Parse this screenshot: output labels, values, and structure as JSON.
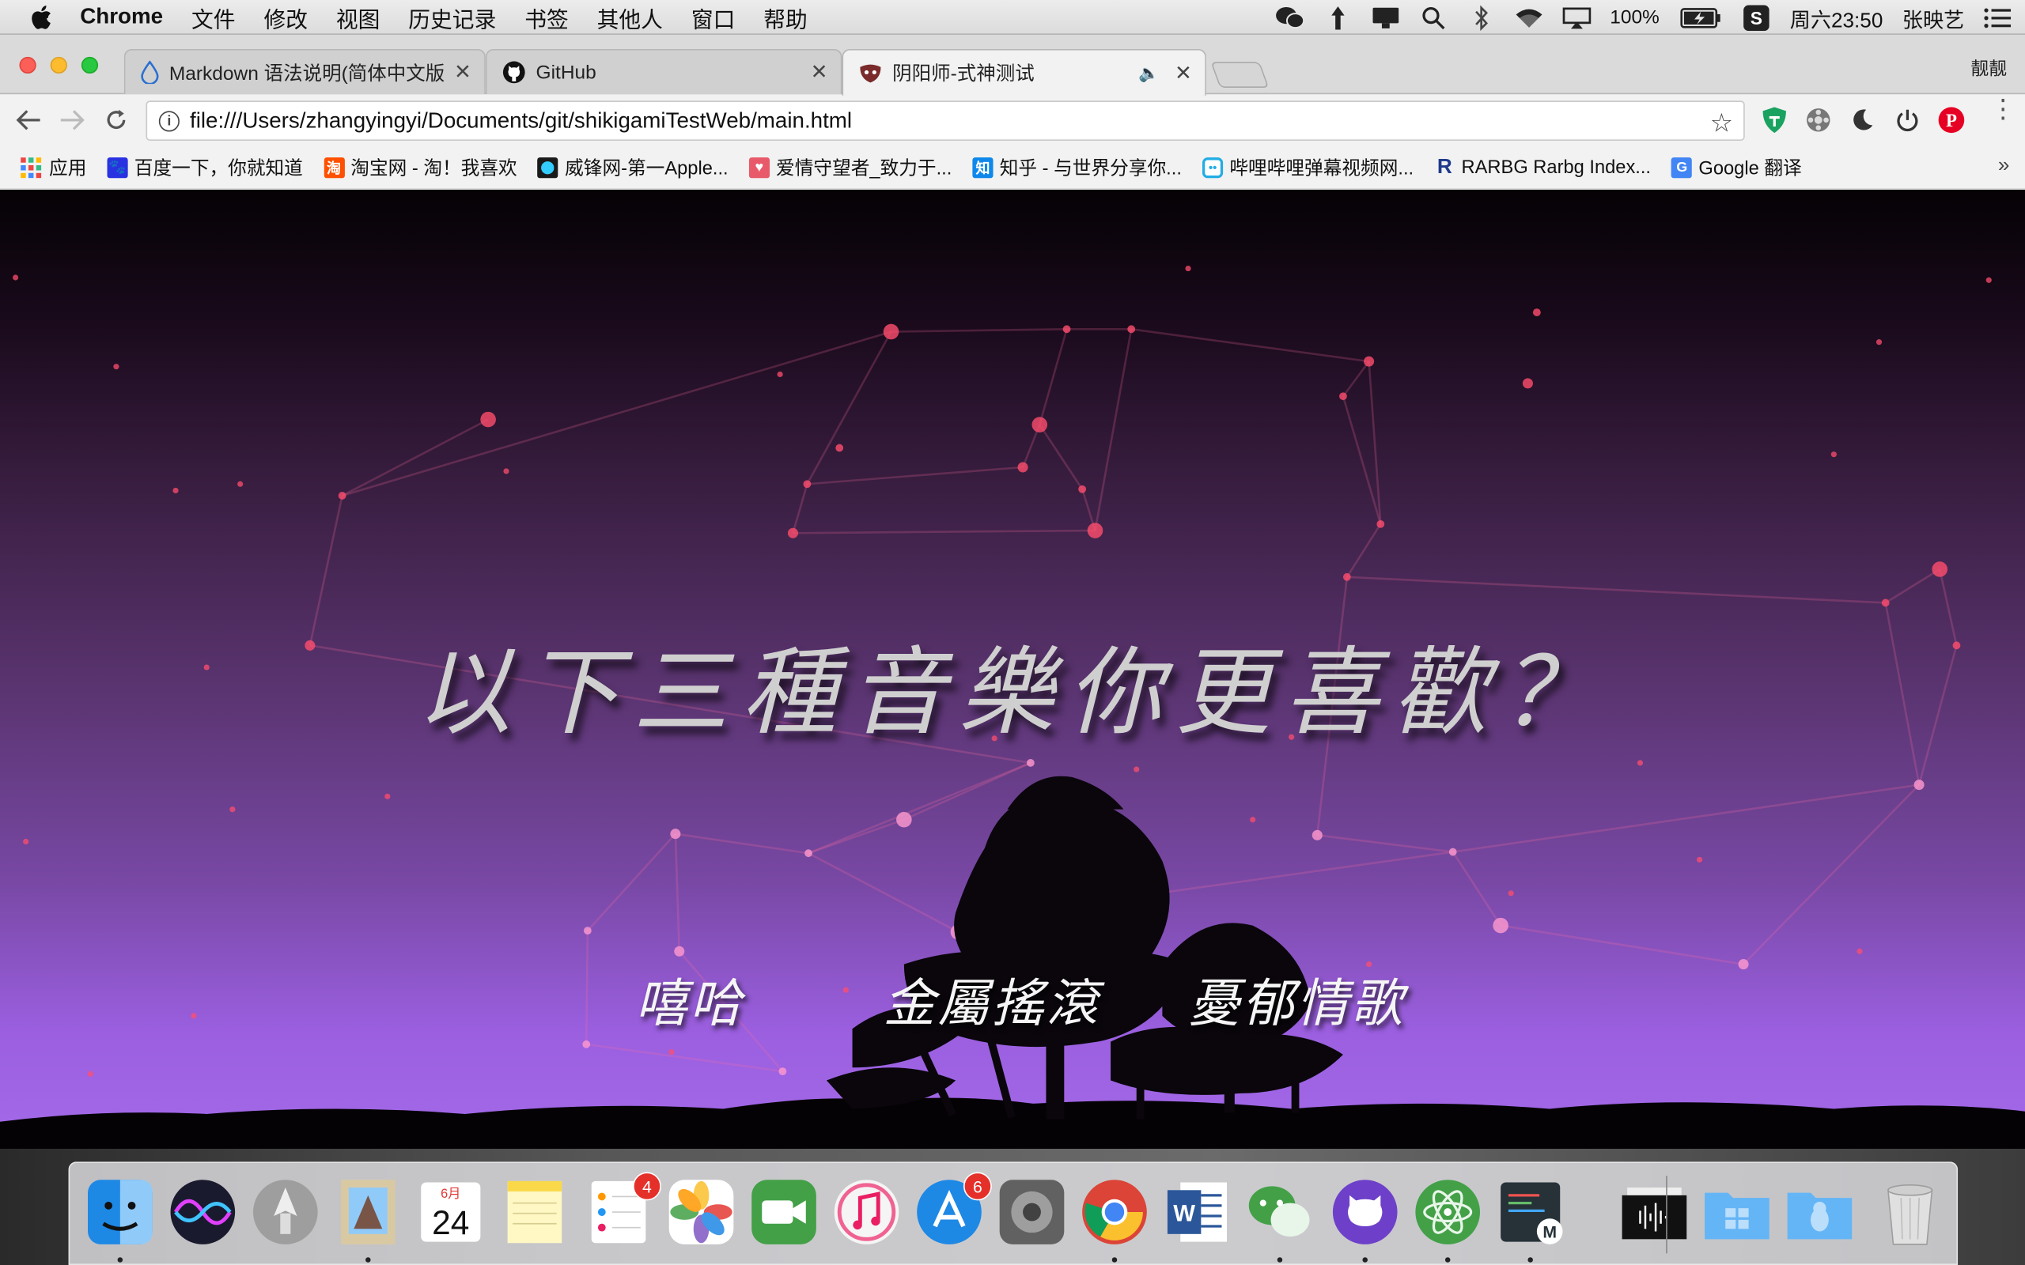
{
  "menubar": {
    "app_name": "Chrome",
    "menus": [
      "文件",
      "修改",
      "视图",
      "历史记录",
      "书签",
      "其他人",
      "窗口",
      "帮助"
    ],
    "battery": "100%",
    "clock": "周六23:50",
    "user": "张映艺"
  },
  "tabs": [
    {
      "title": "Markdown 语法说明(简体中文版",
      "favicon": "droplet-icon",
      "active": false
    },
    {
      "title": "GitHub",
      "favicon": "github-icon",
      "active": false
    },
    {
      "title": "阴阳师-式神测试",
      "favicon": "mask-icon",
      "active": true,
      "audio": true
    }
  ],
  "profile_name": "靓靓",
  "address_bar": {
    "url": "file:///Users/zhangyingyi/Documents/git/shikigamiTestWeb/main.html"
  },
  "bookmarks": [
    {
      "label": "应用",
      "icon": "apps-grid-icon",
      "color": "#e44"
    },
    {
      "label": "百度一下，你就知道",
      "icon": "baidu-paw-icon",
      "color": "#2932e1"
    },
    {
      "label": "淘宝网 - 淘！我喜欢",
      "icon": "taobao-icon",
      "color": "#ff5000"
    },
    {
      "label": "威锋网-第一Apple...",
      "icon": "feng-icon",
      "color": "#1a1a1a"
    },
    {
      "label": "爱情守望者_致力于...",
      "icon": "heart-icon",
      "color": "#e85a6a"
    },
    {
      "label": "知乎 - 与世界分享你...",
      "icon": "zhihu-icon",
      "color": "#0f88eb"
    },
    {
      "label": "哔哩哔哩弹幕视频网...",
      "icon": "bilibili-icon",
      "color": "#23ade5"
    },
    {
      "label": "RARBG Rarbg Index...",
      "icon": "rarbg-icon",
      "color": "#1e3a8a"
    },
    {
      "label": "Google 翻译",
      "icon": "google-translate-icon",
      "color": "#4285f4"
    }
  ],
  "page": {
    "headline": "以下三種音樂你更喜歡？",
    "choices": [
      "嘻哈",
      "金屬搖滾",
      "憂郁情歌"
    ]
  },
  "dock": {
    "apps": [
      {
        "name": "finder-icon",
        "running": true
      },
      {
        "name": "siri-icon",
        "running": false
      },
      {
        "name": "launchpad-icon",
        "running": false
      },
      {
        "name": "mail-icon",
        "running": true
      },
      {
        "name": "calendar-icon",
        "running": false,
        "month": "6月",
        "day": "24"
      },
      {
        "name": "notes-icon",
        "running": false
      },
      {
        "name": "reminders-icon",
        "running": false,
        "badge": "4"
      },
      {
        "name": "photos-icon",
        "running": false
      },
      {
        "name": "facetime-icon",
        "running": false
      },
      {
        "name": "itunes-icon",
        "running": false
      },
      {
        "name": "app-store-icon",
        "running": false,
        "badge": "6"
      },
      {
        "name": "system-preferences-icon",
        "running": false
      },
      {
        "name": "chrome-icon",
        "running": true
      },
      {
        "name": "word-icon",
        "running": false
      },
      {
        "name": "wechat-icon",
        "running": true
      },
      {
        "name": "github-desktop-icon",
        "running": true
      },
      {
        "name": "atom-icon",
        "running": true
      },
      {
        "name": "markdown-editor-icon",
        "running": true
      },
      {
        "name": "audio-folder-icon",
        "running": false
      },
      {
        "name": "windows-folder-icon",
        "running": false
      },
      {
        "name": "linux-folder-icon",
        "running": false
      },
      {
        "name": "trash-icon",
        "running": false
      }
    ]
  }
}
